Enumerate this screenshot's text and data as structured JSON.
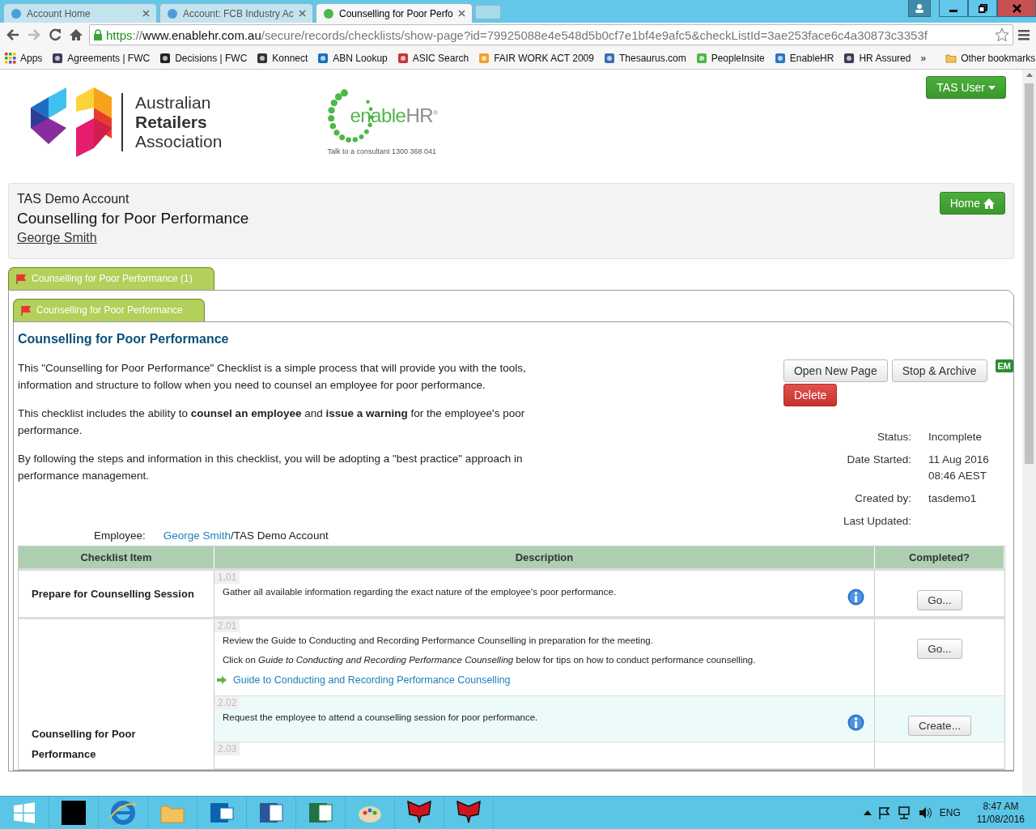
{
  "browser": {
    "tabs": [
      {
        "title": "Account Home",
        "selected": false
      },
      {
        "title": "Account: FCB Industry Ac",
        "selected": false
      },
      {
        "title": "Counselling for Poor Perfo",
        "selected": true
      }
    ],
    "address": {
      "scheme": "https",
      "separator": "://",
      "host": "www.enablehr.com.au",
      "path": "/secure/records/checklists/show-page?id=79925088e4e548d5b0cf7e1bf4e9afc5&checkListId=3ae253face6c4a30873c3353f"
    },
    "bookmarks": [
      "Apps",
      "Agreements | FWC",
      "Decisions | FWC",
      "Konnect",
      "ABN Lookup",
      "ASIC Search",
      "FAIR WORK ACT 2009",
      "Thesaurus.com",
      "PeopleInsite",
      "EnableHR",
      "HR Assured"
    ],
    "more_bookmarks": "»",
    "other_bookmarks": "Other bookmarks"
  },
  "header": {
    "association_lines": [
      "Australian",
      "Retailers",
      "Association"
    ],
    "brand": "enable",
    "brand_suffix": "HR",
    "brand_mark": "®",
    "tagline": "Talk to a consultant 1300 368 041",
    "user_button": "TAS User"
  },
  "record": {
    "account": "TAS Demo Account",
    "title": "Counselling for Poor Performance",
    "employee": "George Smith",
    "home_button": "Home"
  },
  "outer_tab": {
    "label": "Counselling for Poor Performance (1)",
    "selected": true
  },
  "inner_tab": {
    "label": "Counselling for Poor Performance",
    "selected": true
  },
  "checklist": {
    "heading": "Counselling for Poor Performance",
    "paragraphs": [
      "This \"Counselling for Poor Performance\" Checklist is a simple process that will provide you with the tools, information and structure to follow when you need to counsel an employee for poor performance.",
      "This checklist includes the ability to **counsel an employee** and **issue a warning** for the employee's poor performance.",
      "By following the steps and information in this checklist, you will be adopting a \"best practice\" approach in performance management."
    ],
    "buttons": [
      {
        "label": "Open New Page",
        "kind": "default"
      },
      {
        "label": "Stop & Archive",
        "kind": "default"
      },
      {
        "label": "Delete",
        "kind": "danger"
      }
    ],
    "badge": "EM",
    "meta": [
      {
        "label": "Status:",
        "value": [
          "Incomplete"
        ]
      },
      {
        "label": "Date Started:",
        "value": [
          "11 Aug 2016",
          "08:46 AEST"
        ]
      },
      {
        "label": "Created by:",
        "value": [
          "tasdemo1"
        ]
      },
      {
        "label": "Last Updated:"
      }
    ],
    "employee_label": "Employee:",
    "employee_link": "George Smith",
    "employee_account": "/TAS Demo Account"
  },
  "table": {
    "columns": [
      "Checklist Item",
      "Description",
      "Completed?"
    ],
    "sections": [
      {
        "item": "Prepare for Counselling Session",
        "steps": [
          {
            "number": "1.01",
            "paragraphs": [
              "Gather all available information regarding the exact nature of the employee's poor performance."
            ],
            "info": true,
            "highlighted": false,
            "action": "Go..."
          }
        ]
      },
      {
        "item": "Counselling for Poor Performance",
        "steps": [
          {
            "number": "2.01",
            "paragraphs": [
              "Review the Guide to Conducting and Recording Performance Counselling in preparation for the meeting.",
              "Click on *Guide to Conducting and Recording Performance Counselling* below for tips on how to conduct performance counselling."
            ],
            "link": "Guide to Conducting and Recording Performance Counselling",
            "info": false,
            "highlighted": false,
            "action": "Go..."
          },
          {
            "number": "2.02",
            "paragraphs": [
              "Request the employee to attend a counselling session for poor performance."
            ],
            "info": true,
            "highlighted": true,
            "action": "Create..."
          },
          {
            "number": "2.03",
            "info": false,
            "highlighted": false
          }
        ]
      }
    ]
  },
  "taskbar": {
    "language": "ENG",
    "time": "8:47 AM",
    "date": "11/08/2016"
  }
}
